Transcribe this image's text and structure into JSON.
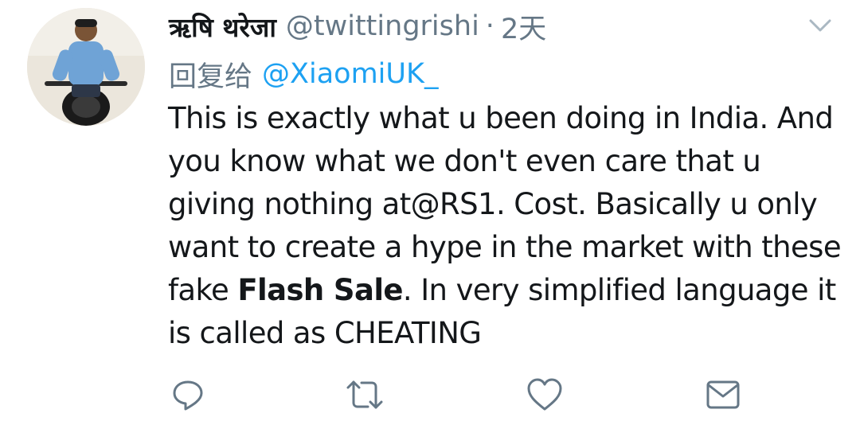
{
  "tweet": {
    "display_name": "ऋषि थरेजा",
    "handle": "@twittingrishi",
    "separator": "·",
    "time": "2天",
    "reply_label": "回复给",
    "reply_target": "@XiaomiUK_",
    "text_part1": "This is exactly what u been doing in India. And you know what we don't even care that u giving nothing at@RS1. Cost. Basically u only want to create a hype in the market with these fake ",
    "text_bold": "Flash Sale",
    "text_part2": ". In very simplified language it is called as CHEATING"
  },
  "icons": {
    "menu": "chevron-down-icon",
    "reply": "reply-icon",
    "retweet": "retweet-icon",
    "like": "heart-icon",
    "message": "mail-icon"
  },
  "colors": {
    "text": "#14171a",
    "secondary": "#657786",
    "link": "#1da1f2",
    "icon": "#657786"
  }
}
